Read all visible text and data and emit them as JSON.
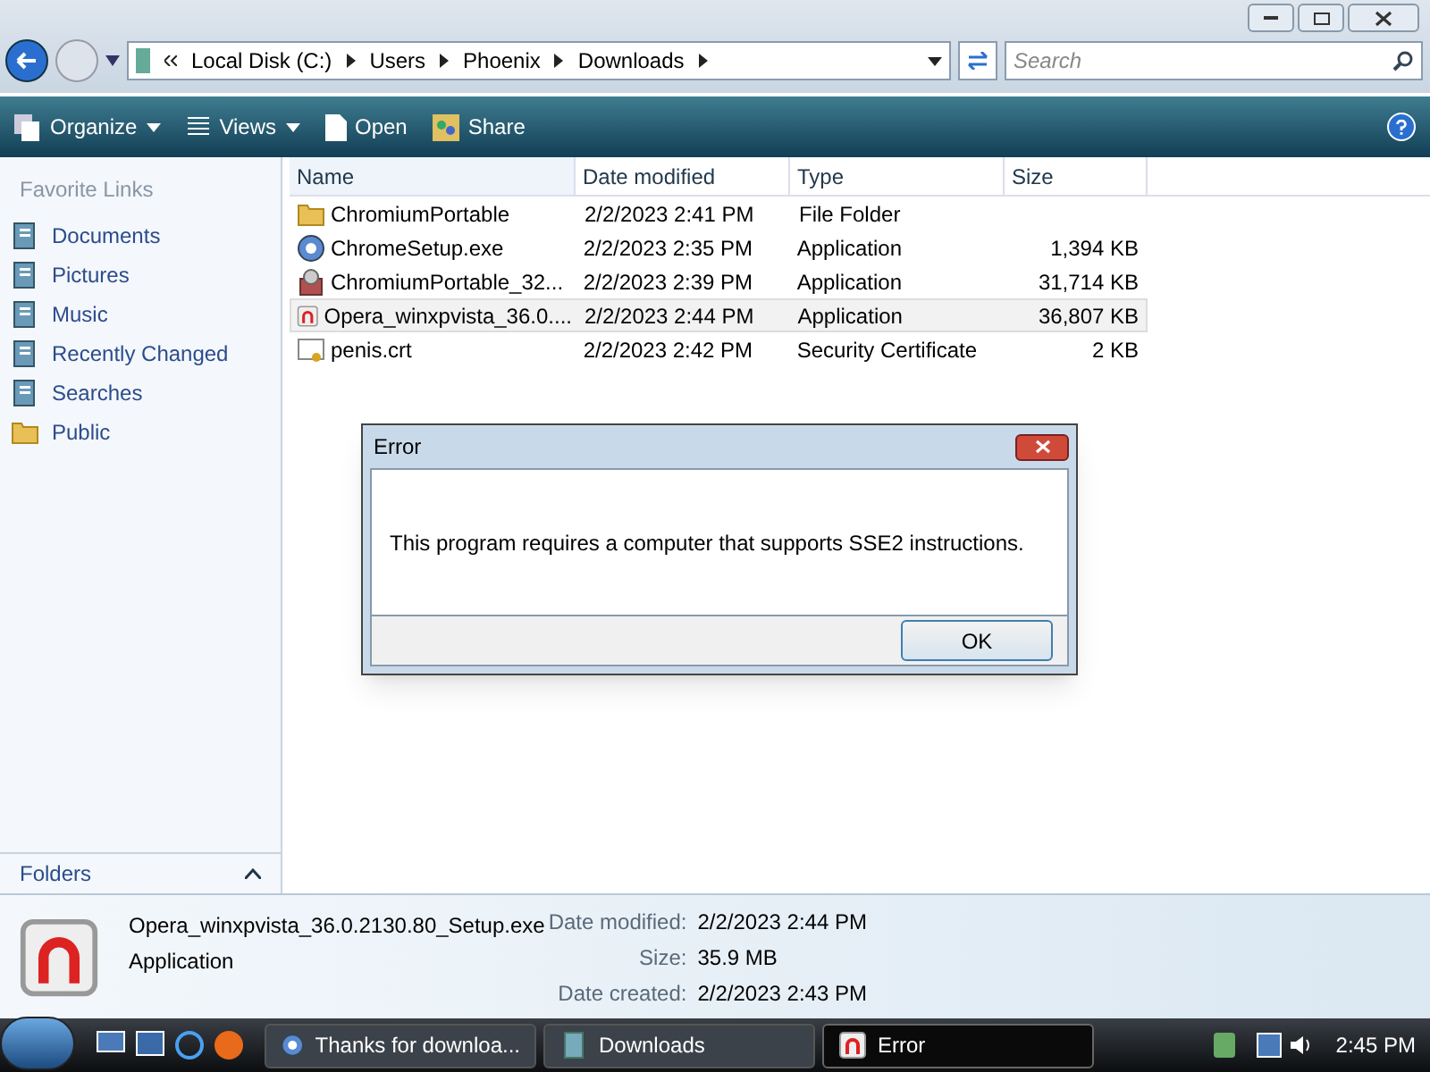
{
  "address": {
    "segments": [
      "Local Disk (C:)",
      "Users",
      "Phoenix",
      "Downloads"
    ]
  },
  "search": {
    "placeholder": "Search"
  },
  "toolbar": [
    {
      "label": "Organize",
      "kind": "organize"
    },
    {
      "label": "Views",
      "kind": "views"
    },
    {
      "label": "Open",
      "kind": "open"
    },
    {
      "label": "Share",
      "kind": "share"
    }
  ],
  "sidebar": {
    "title": "Favorite Links",
    "items": [
      {
        "label": "Documents",
        "kind": "documents"
      },
      {
        "label": "Pictures",
        "kind": "pictures"
      },
      {
        "label": "Music",
        "kind": "music"
      },
      {
        "label": "Recently Changed",
        "kind": "recent"
      },
      {
        "label": "Searches",
        "kind": "searches"
      },
      {
        "label": "Public",
        "kind": "folder"
      }
    ],
    "folders": "Folders"
  },
  "table": {
    "columns": [
      "Name",
      "Date modified",
      "Type",
      "Size"
    ],
    "rows": [
      {
        "name": "ChromiumPortable",
        "date": "2/2/2023 2:41 PM",
        "type": "File Folder",
        "kind": "folder",
        "selected": false
      },
      {
        "name": "ChromeSetup.exe",
        "date": "2/2/2023 2:35 PM",
        "type": "Application",
        "size": "1,394 KB",
        "kind": "chrome",
        "selected": false
      },
      {
        "name": "ChromiumPortable_32...",
        "date": "2/2/2023 2:39 PM",
        "type": "Application",
        "size": "31,714 KB",
        "kind": "package",
        "selected": false
      },
      {
        "name": "Opera_winxpvista_36.0....",
        "date": "2/2/2023 2:44 PM",
        "type": "Application",
        "size": "36,807 KB",
        "kind": "opera",
        "selected": true
      },
      {
        "name": "penis.crt",
        "date": "2/2/2023 2:42 PM",
        "type": "Security Certificate",
        "size": "2 KB",
        "kind": "cert",
        "selected": false
      }
    ]
  },
  "dialog": {
    "title": "Error",
    "message": "This program requires a computer that supports SSE2 instructions.",
    "button": "OK"
  },
  "details": {
    "name": "Opera_winxpvista_36.0.2130.80_Setup.exe",
    "type": "Application",
    "fields": [
      {
        "label": "Date modified:",
        "value": "2/2/2023 2:44 PM"
      },
      {
        "label": "Size:",
        "value": "35.9 MB"
      },
      {
        "label": "Date created:",
        "value": "2/2/2023 2:43 PM"
      }
    ]
  },
  "taskbar": {
    "buttons": [
      {
        "label": "Thanks for downloa...",
        "kind": "chrome",
        "selected": false
      },
      {
        "label": "Downloads",
        "kind": "explorer",
        "selected": false
      },
      {
        "label": "Error",
        "kind": "opera",
        "selected": true
      }
    ],
    "clock": "2:45 PM"
  }
}
